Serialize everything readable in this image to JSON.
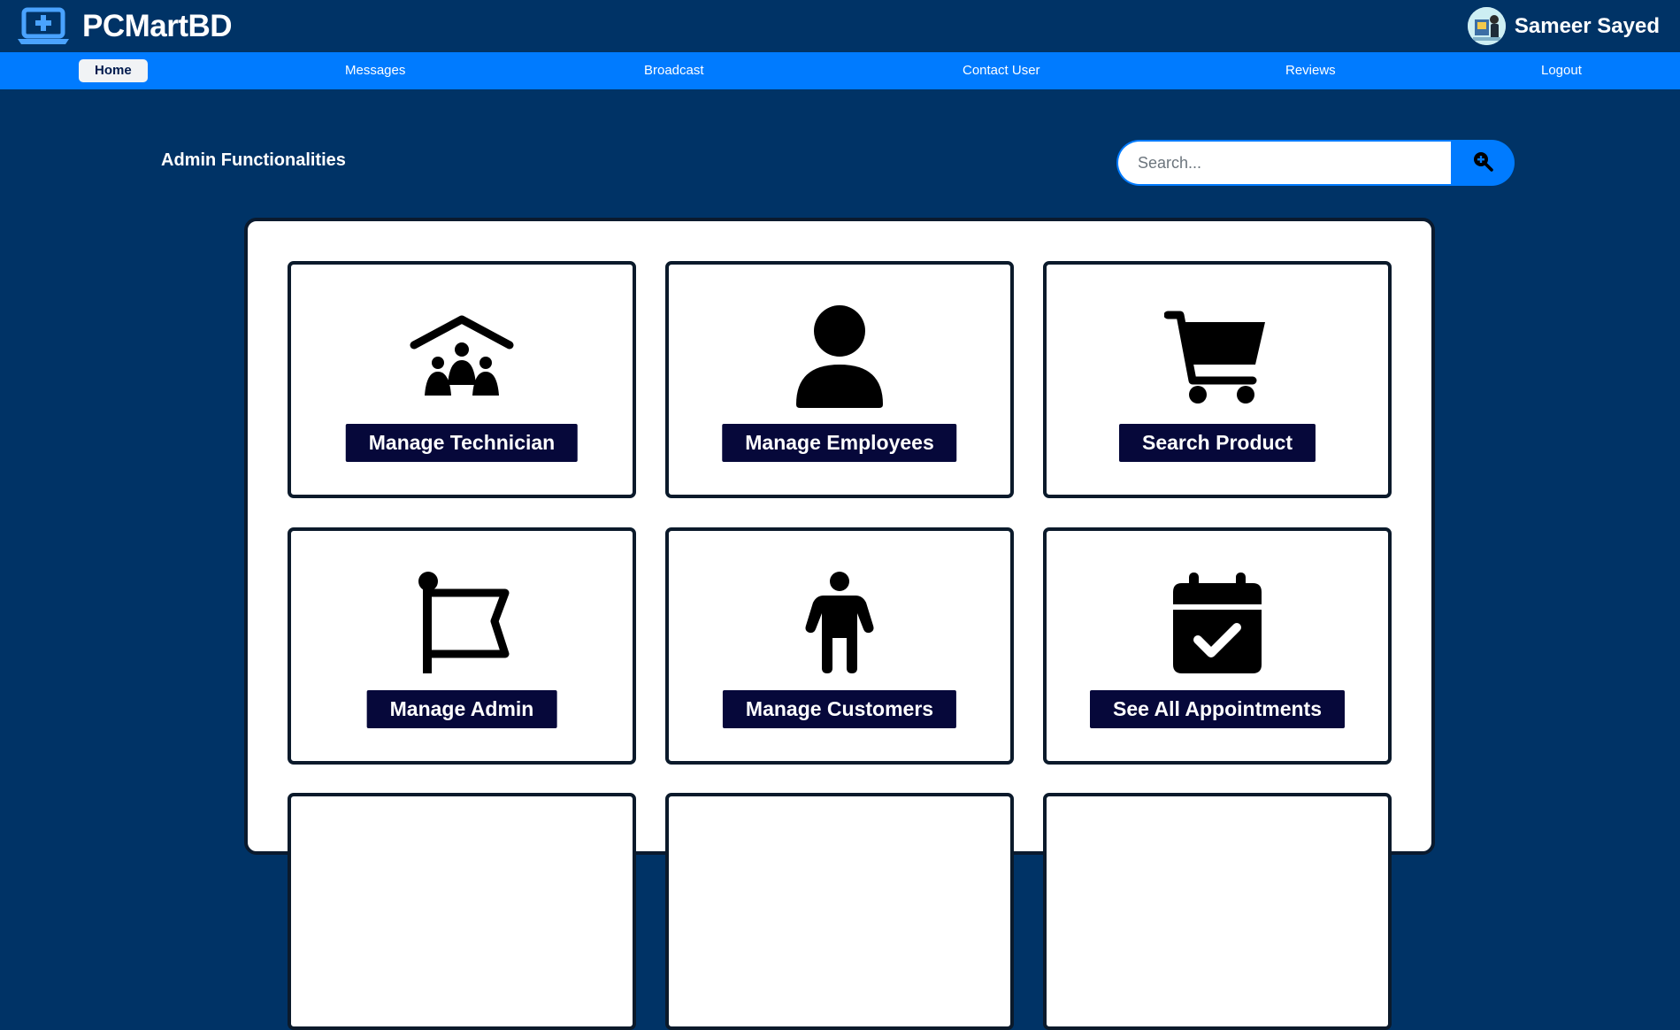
{
  "header": {
    "brand": "PCMartBD",
    "user_name": "Sameer Sayed"
  },
  "nav": {
    "items": [
      "Home",
      "Messages",
      "Broadcast",
      "Contact User",
      "Reviews",
      "Logout"
    ],
    "active": "Home"
  },
  "main": {
    "heading": "Admin Functionalities"
  },
  "search": {
    "placeholder": "Search..."
  },
  "cards": [
    {
      "label": "Manage Technician",
      "icon": "technician-group-icon"
    },
    {
      "label": "Manage Employees",
      "icon": "person-icon"
    },
    {
      "label": "Search Product",
      "icon": "shopping-cart-icon"
    },
    {
      "label": "Manage Admin",
      "icon": "flag-icon"
    },
    {
      "label": "Manage Customers",
      "icon": "person-standing-icon"
    },
    {
      "label": "See All Appointments",
      "icon": "calendar-check-icon"
    }
  ],
  "colors": {
    "background": "#003366",
    "nav": "#007bff",
    "card_button": "#06083a"
  }
}
